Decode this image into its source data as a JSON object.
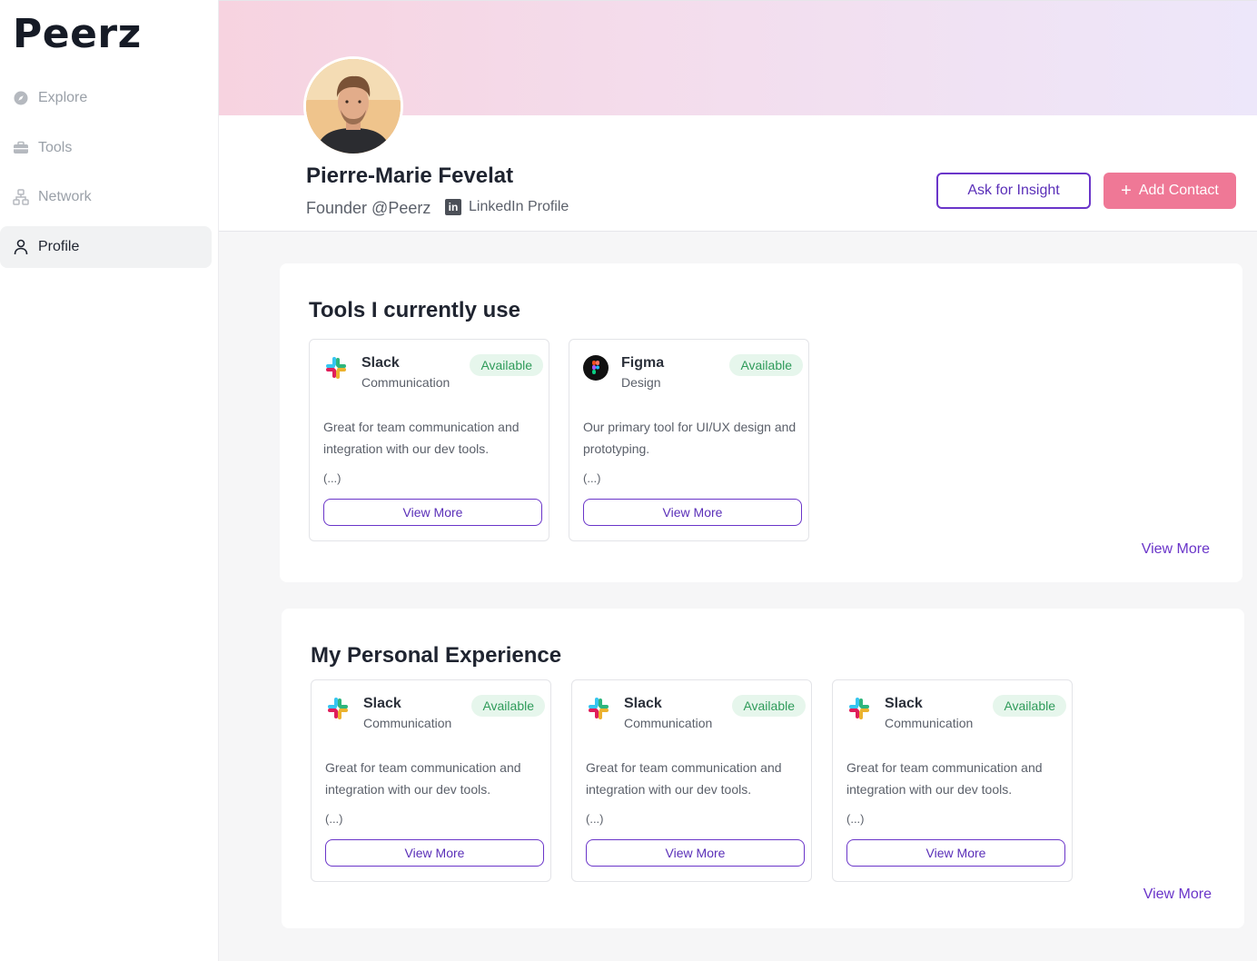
{
  "app": {
    "logo": "Peerz"
  },
  "sidebar": {
    "items": [
      {
        "label": "Explore",
        "icon": "compass-icon"
      },
      {
        "label": "Tools",
        "icon": "toolbox-icon"
      },
      {
        "label": "Network",
        "icon": "network-icon"
      },
      {
        "label": "Profile",
        "icon": "user-icon",
        "active": true
      }
    ]
  },
  "profile": {
    "name": "Pierre-Marie Fevelat",
    "role": "Founder @Peerz",
    "linkedin_label": "LinkedIn Profile",
    "ask_insight_label": "Ask for Insight",
    "add_contact_label": "Add Contact"
  },
  "tools_section": {
    "title": "Tools I currently use",
    "view_more": "View More",
    "cards": [
      {
        "name": "Slack",
        "category": "Communication",
        "badge": "Available",
        "description": "Great for team communication and integration with our dev tools.",
        "ellipsis": "(...)",
        "button": "View More",
        "logo": "slack-icon"
      },
      {
        "name": "Figma",
        "category": "Design",
        "badge": "Available",
        "description": "Our primary tool for UI/UX design and prototyping.",
        "ellipsis": "(...)",
        "button": "View More",
        "logo": "figma-icon"
      }
    ]
  },
  "experience_section": {
    "title": "My Personal Experience",
    "view_more": "View More",
    "cards": [
      {
        "name": "Slack",
        "category": "Communication",
        "badge": "Available",
        "description": "Great for team communication and integration with our dev tools.",
        "ellipsis": "(...)",
        "button": "View More",
        "logo": "slack-icon"
      },
      {
        "name": "Slack",
        "category": "Communication",
        "badge": "Available",
        "description": "Great for team communication and integration with our dev tools.",
        "ellipsis": "(...)",
        "button": "View More",
        "logo": "slack-icon"
      },
      {
        "name": "Slack",
        "category": "Communication",
        "badge": "Available",
        "description": "Great for team communication and integration with our dev tools.",
        "ellipsis": "(...)",
        "button": "View More",
        "logo": "slack-icon"
      }
    ]
  },
  "colors": {
    "accent": "#6a35c9",
    "add_button": "#ef7896",
    "badge_bg": "#e6f6ec",
    "badge_text": "#2f9b5a"
  }
}
